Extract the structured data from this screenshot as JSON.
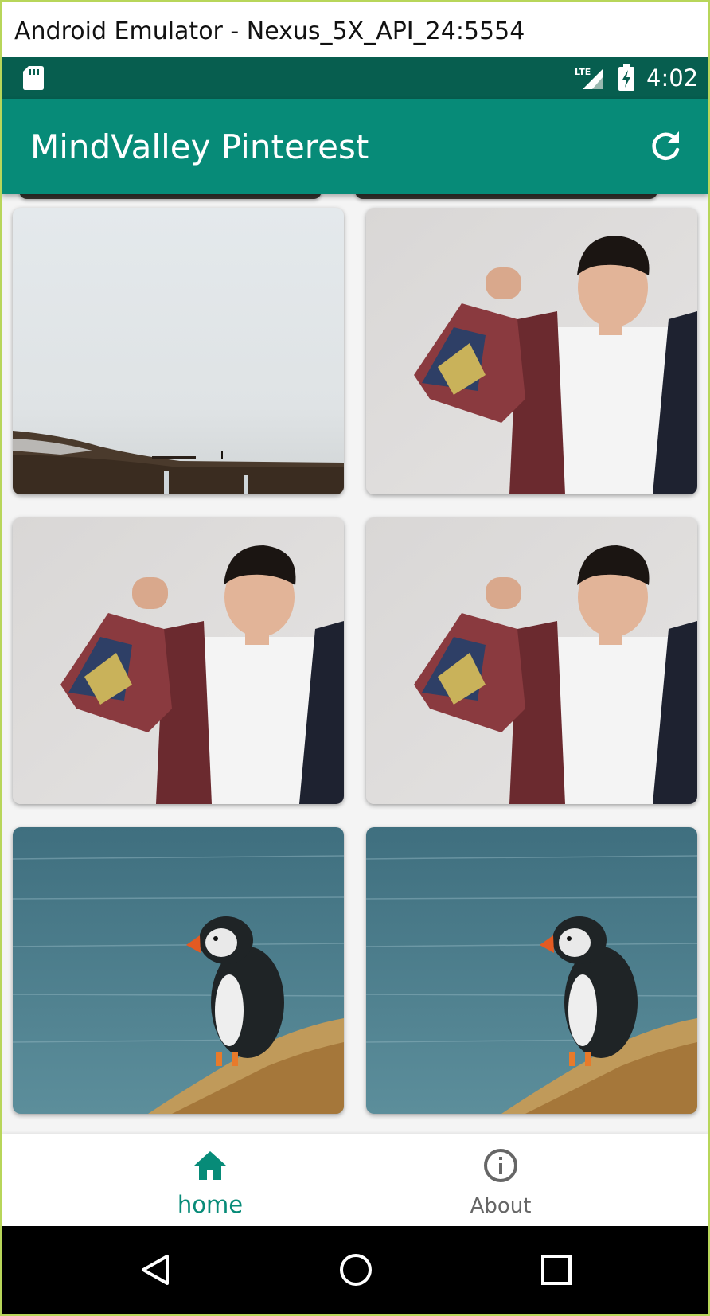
{
  "window": {
    "title": "Android Emulator - Nexus_5X_API_24:5554"
  },
  "status_bar": {
    "time": "4:02",
    "network": "LTE",
    "icons": [
      "sd-card-icon",
      "lte-signal-icon",
      "battery-charging-icon"
    ]
  },
  "app_bar": {
    "title": "MindValley Pinterest",
    "action_icon": "refresh-icon"
  },
  "colors": {
    "primary": "#078b78",
    "primary_dark": "#075e4f",
    "inactive": "#666666",
    "frame": "#b8d65a"
  },
  "feed": {
    "cards": [
      {
        "image": "foggy-mountain-landscape"
      },
      {
        "image": "man-in-patterned-cardigan"
      },
      {
        "image": "man-in-patterned-cardigan"
      },
      {
        "image": "man-in-patterned-cardigan"
      },
      {
        "image": "puffin-on-cliff-over-sea"
      },
      {
        "image": "puffin-on-cliff-over-sea"
      }
    ]
  },
  "bottom_nav": {
    "items": [
      {
        "label": "home",
        "icon": "home-icon",
        "active": true
      },
      {
        "label": "About",
        "icon": "info-icon",
        "active": false
      }
    ]
  },
  "system_nav": {
    "icons": [
      "back-icon",
      "home-circle-icon",
      "recents-icon"
    ]
  }
}
